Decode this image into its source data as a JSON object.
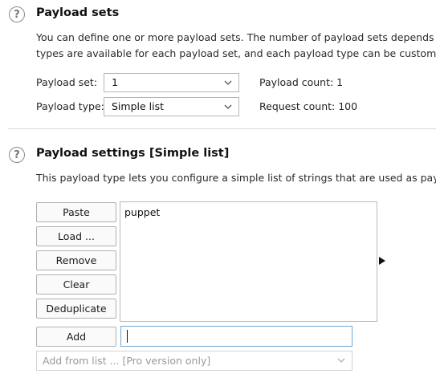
{
  "payload_sets": {
    "title": "Payload sets",
    "desc_line1": "You can define one or more payload sets. The number of payload sets depends o",
    "desc_line2": "types are available for each payload set, and each payload type can be customized",
    "payload_set_label": "Payload set:",
    "payload_set_value": "1",
    "payload_type_label": "Payload type:",
    "payload_type_value": "Simple list",
    "payload_count": "Payload count: 1",
    "request_count": "Request count: 100"
  },
  "payload_settings": {
    "title": "Payload settings [Simple list]",
    "desc": "This payload type lets you configure a simple list of strings that are used as paylo",
    "buttons": {
      "paste": "Paste",
      "load": "Load ...",
      "remove": "Remove",
      "clear": "Clear",
      "deduplicate": "Deduplicate",
      "add": "Add"
    },
    "list_items": [
      "puppet"
    ],
    "add_input_value": "",
    "add_from_list": "Add from list ... [Pro version only]"
  },
  "icons": {
    "help": "help-circle-icon",
    "dropdown": "chevron-down-icon",
    "expand": "triangle-right-icon"
  }
}
